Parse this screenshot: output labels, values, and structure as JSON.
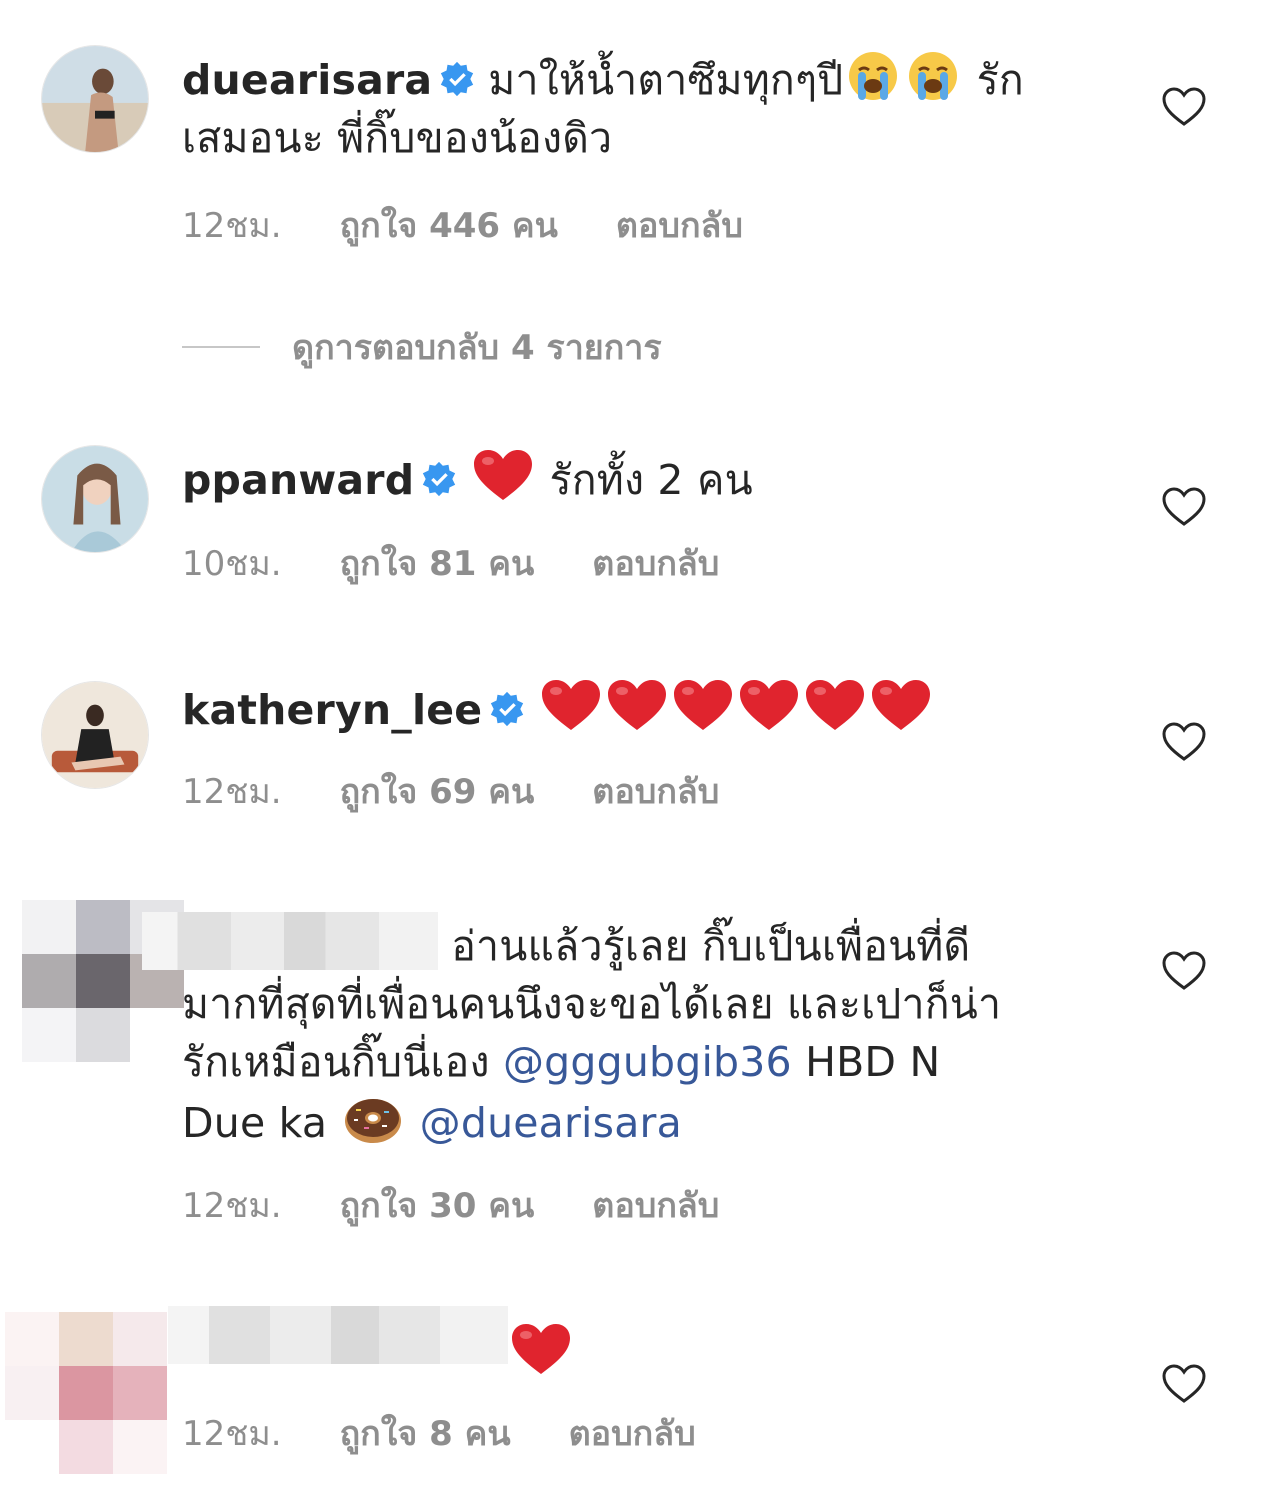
{
  "comments": [
    {
      "username": "duearisara",
      "verified": true,
      "text_line1": "มาให้น้ำตาซึมทุกๆปี",
      "text_tail": "รัก",
      "text_line2": "เสมอนะ พี่กิ๊บของน้องดิว",
      "time": "12ชม.",
      "likes": "ถูกใจ 446 คน",
      "reply": "ตอบกลับ"
    },
    {
      "username": "ppanward",
      "verified": true,
      "text": "รักทั้ง 2 คน",
      "time": "10ชม.",
      "likes": "ถูกใจ 81 คน",
      "reply": "ตอบกลับ"
    },
    {
      "username": "katheryn_lee",
      "verified": true,
      "time": "12ชม.",
      "likes": "ถูกใจ 69 คน",
      "reply": "ตอบกลับ"
    },
    {
      "text_line1": "อ่านแล้วรู้เลย กิ๊บเป็นเพื่อนที่ดี",
      "text_line2": "มากที่สุดที่เพื่อนคนนึงจะขอได้เลย และเปาก็น่า",
      "text_line3a": "รักเหมือนกิ๊บนี่เอง",
      "mention1": "@gggubgib36",
      "text_line3b": "HBD N",
      "text_line4": "Due ka",
      "mention2": "@duearisara",
      "time": "12ชม.",
      "likes": "ถูกใจ 30 คน",
      "reply": "ตอบกลับ"
    },
    {
      "time": "12ชม.",
      "likes": "ถูกใจ 8 คน",
      "reply": "ตอบกลับ"
    }
  ],
  "view_replies": "ดูการตอบกลับ 4 รายการ",
  "icons": {
    "like": "heart-outline-icon",
    "verified": "verified-badge-icon",
    "heart_color": "#e0242e",
    "verified_color": "#3897f0"
  }
}
